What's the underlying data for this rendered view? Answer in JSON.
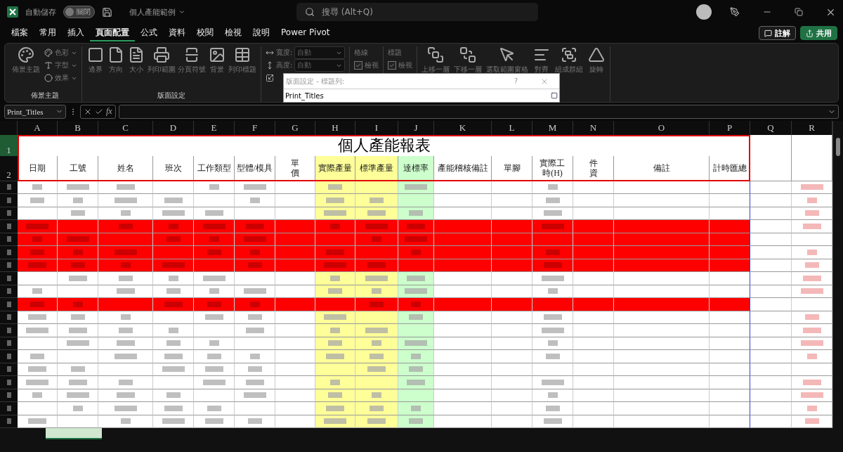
{
  "title_bar": {
    "autosave_label": "自動儲存",
    "autosave_toggle": {
      "label": "關閉",
      "on": false
    },
    "file_name": "個人產能範例",
    "search_placeholder": "搜尋 (Alt+Q)"
  },
  "menu_tabs": [
    {
      "label": "檔案",
      "selected": false
    },
    {
      "label": "常用",
      "selected": false
    },
    {
      "label": "插入",
      "selected": false
    },
    {
      "label": "頁面配置",
      "selected": true
    },
    {
      "label": "公式",
      "selected": false
    },
    {
      "label": "資料",
      "selected": false
    },
    {
      "label": "校閱",
      "selected": false
    },
    {
      "label": "檢視",
      "selected": false
    },
    {
      "label": "說明",
      "selected": false
    },
    {
      "label": "Power Pivot",
      "selected": false
    }
  ],
  "header_buttons": {
    "comments": "註解",
    "share": "共用"
  },
  "ribbon": {
    "themes": {
      "label": "佈景主題",
      "main": "佈景主題",
      "items": [
        "色彩",
        "字型",
        "效果"
      ]
    },
    "page_setup": {
      "label": "版面設定",
      "items": [
        "邊界",
        "方向",
        "大小",
        "列印範圍",
        "分頁符號",
        "背景",
        "列印標題"
      ]
    },
    "scale": [
      {
        "label": "寬度:",
        "value": "自動"
      },
      {
        "label": "高度:",
        "value": "自動"
      }
    ],
    "sheet_options": [
      {
        "label": "格線",
        "option": "檢視",
        "checked": true
      },
      {
        "label": "標題",
        "option": "檢視",
        "checked": true
      }
    ],
    "arrange": [
      "上移一層",
      "下移一層",
      "選取範圍窗格",
      "對齊",
      "組成群組",
      "旋轉"
    ]
  },
  "dialog": {
    "title": "版面設定 - 標題列:",
    "help": "?",
    "value": "Print_Titles"
  },
  "formula_bar": {
    "name_box": "Print_Titles",
    "function_label": "fx"
  },
  "sheet": {
    "title": "個人產能報表",
    "columns": [
      {
        "letter": "A",
        "header": "日期"
      },
      {
        "letter": "B",
        "header": "工號"
      },
      {
        "letter": "C",
        "header": "姓名"
      },
      {
        "letter": "D",
        "header": "班次"
      },
      {
        "letter": "E",
        "header": "工作類型"
      },
      {
        "letter": "F",
        "header": "型體/模具"
      },
      {
        "letter": "G",
        "header": "單價"
      },
      {
        "letter": "H",
        "header": "實際產量",
        "color": "#ffff99"
      },
      {
        "letter": "I",
        "header": "標準產量",
        "color": "#ffff99"
      },
      {
        "letter": "J",
        "header": "達標率",
        "color": "#ccffcc"
      },
      {
        "letter": "K",
        "header": "產能稽核備註"
      },
      {
        "letter": "L",
        "header": "單腳"
      },
      {
        "letter": "M",
        "header": "實際工時(H)"
      },
      {
        "letter": "N",
        "header": "件資"
      },
      {
        "letter": "O",
        "header": "備註"
      },
      {
        "letter": "P",
        "header": "計時匯總"
      },
      {
        "letter": "Q"
      },
      {
        "letter": "R"
      }
    ],
    "row_numbers": [
      "1",
      "2"
    ],
    "rows": [
      {
        "highlighted": false
      },
      {
        "highlighted": false
      },
      {
        "highlighted": false
      },
      {
        "highlighted": true
      },
      {
        "highlighted": true
      },
      {
        "highlighted": true
      },
      {
        "highlighted": true
      },
      {
        "highlighted": false
      },
      {
        "highlighted": false
      },
      {
        "highlighted": true
      },
      {
        "highlighted": false
      },
      {
        "highlighted": false
      },
      {
        "highlighted": false
      },
      {
        "highlighted": false
      },
      {
        "highlighted": false
      },
      {
        "highlighted": false
      },
      {
        "highlighted": false
      },
      {
        "highlighted": false
      },
      {
        "highlighted": false
      }
    ]
  }
}
